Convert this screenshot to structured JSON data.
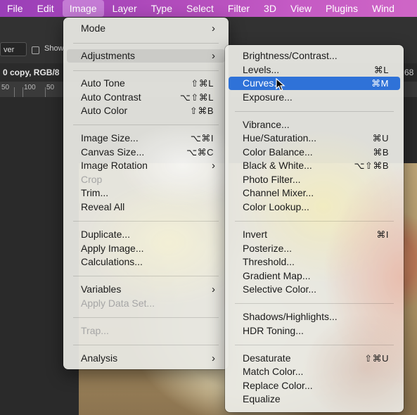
{
  "menubar": {
    "items": [
      "File",
      "Edit",
      "Image",
      "Layer",
      "Type",
      "Select",
      "Filter",
      "3D",
      "View",
      "Plugins",
      "Wind"
    ],
    "active": "Image"
  },
  "options_bar": {
    "dropdown": "ver",
    "checkbox_label": "Show"
  },
  "doc_tab": {
    "title": "0 copy, RGB/8",
    "right_text": "68"
  },
  "ruler": {
    "ticks": [
      "50",
      "100",
      "50"
    ]
  },
  "image_menu": {
    "mode": "Mode",
    "adjustments": "Adjustments",
    "auto_tone": "Auto Tone",
    "auto_tone_sc": "⇧⌘L",
    "auto_contrast": "Auto Contrast",
    "auto_contrast_sc": "⌥⇧⌘L",
    "auto_color": "Auto Color",
    "auto_color_sc": "⇧⌘B",
    "image_size": "Image Size...",
    "image_size_sc": "⌥⌘I",
    "canvas_size": "Canvas Size...",
    "canvas_size_sc": "⌥⌘C",
    "image_rotation": "Image Rotation",
    "crop": "Crop",
    "trim": "Trim...",
    "reveal_all": "Reveal All",
    "duplicate": "Duplicate...",
    "apply_image": "Apply Image...",
    "calculations": "Calculations...",
    "variables": "Variables",
    "apply_data_set": "Apply Data Set...",
    "trap": "Trap...",
    "analysis": "Analysis"
  },
  "adjustments_menu": {
    "brightness_contrast": "Brightness/Contrast...",
    "levels": "Levels...",
    "levels_sc": "⌘L",
    "curves": "Curves...",
    "curves_sc": "⌘M",
    "exposure": "Exposure...",
    "vibrance": "Vibrance...",
    "hue_saturation": "Hue/Saturation...",
    "hue_saturation_sc": "⌘U",
    "color_balance": "Color Balance...",
    "color_balance_sc": "⌘B",
    "black_white": "Black & White...",
    "black_white_sc": "⌥⇧⌘B",
    "photo_filter": "Photo Filter...",
    "channel_mixer": "Channel Mixer...",
    "color_lookup": "Color Lookup...",
    "invert": "Invert",
    "invert_sc": "⌘I",
    "posterize": "Posterize...",
    "threshold": "Threshold...",
    "gradient_map": "Gradient Map...",
    "selective_color": "Selective Color...",
    "shadows_highlights": "Shadows/Highlights...",
    "hdr_toning": "HDR Toning...",
    "desaturate": "Desaturate",
    "desaturate_sc": "⇧⌘U",
    "match_color": "Match Color...",
    "replace_color": "Replace Color...",
    "equalize": "Equalize"
  },
  "colors": {
    "menubar": "#b04bbb",
    "highlight": "#2f72d8",
    "disabled": "#a6a6a6"
  }
}
